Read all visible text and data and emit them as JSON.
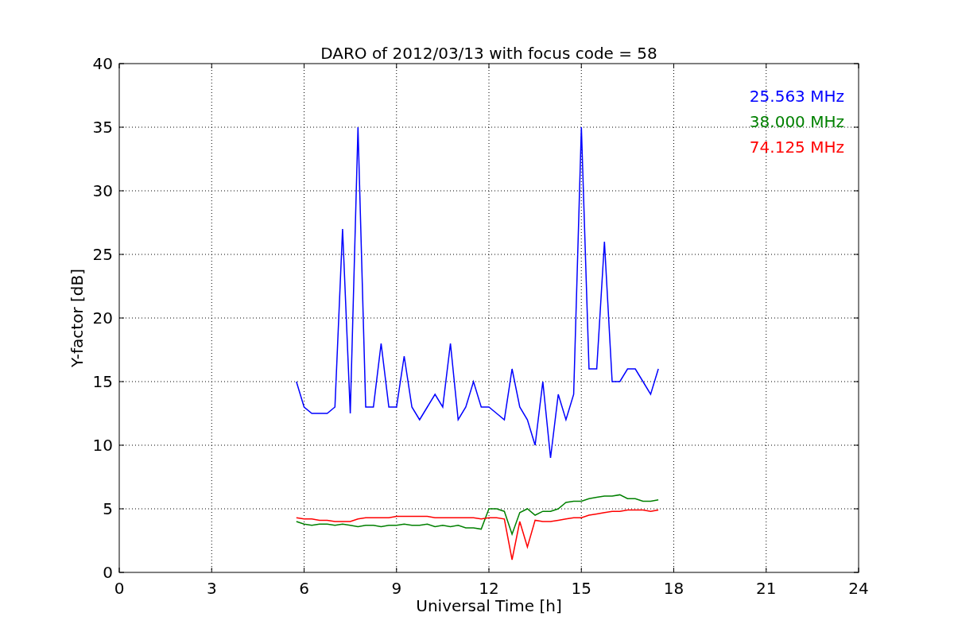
{
  "figure": {
    "chart_data": {
      "type": "line",
      "title": "DARO of 2012/03/13 with focus code = 58",
      "xlabel": "Universal Time [h]",
      "ylabel": "Y-factor [dB]",
      "x": [
        5.75,
        6,
        6.25,
        6.5,
        6.75,
        7,
        7.25,
        7.5,
        7.75,
        8,
        8.25,
        8.5,
        8.75,
        9,
        9.25,
        9.5,
        9.75,
        10,
        10.25,
        10.5,
        10.75,
        11,
        11.25,
        11.5,
        11.75,
        12,
        12.25,
        12.5,
        12.75,
        13,
        13.25,
        13.5,
        13.75,
        14,
        14.25,
        14.5,
        14.75,
        15,
        15.25,
        15.5,
        15.75,
        16,
        16.25,
        16.5,
        16.75,
        17,
        17.25,
        17.5
      ],
      "series": [
        {
          "name": "25.563 MHz",
          "color": "#0000ff",
          "values": [
            15,
            13,
            12.5,
            12.5,
            12.5,
            13,
            27,
            12.5,
            35,
            13,
            13,
            18,
            13,
            13,
            17,
            13,
            12,
            13,
            14,
            13,
            18,
            12,
            13,
            15,
            13,
            13,
            12.5,
            12,
            16,
            13,
            12,
            10,
            15,
            9,
            14,
            12,
            14,
            35,
            16,
            16,
            26,
            15,
            15,
            16,
            16,
            15,
            14,
            16
          ]
        },
        {
          "name": "38.000 MHz",
          "color": "#008000",
          "values": [
            4,
            3.8,
            3.7,
            3.8,
            3.8,
            3.7,
            3.8,
            3.7,
            3.6,
            3.7,
            3.7,
            3.6,
            3.7,
            3.7,
            3.8,
            3.7,
            3.7,
            3.8,
            3.6,
            3.7,
            3.6,
            3.7,
            3.5,
            3.5,
            3.4,
            5,
            5,
            4.8,
            3,
            4.7,
            5,
            4.5,
            4.8,
            4.8,
            5,
            5.5,
            5.6,
            5.6,
            5.8,
            5.9,
            6,
            6,
            6.1,
            5.8,
            5.8,
            5.6,
            5.6,
            5.7
          ]
        },
        {
          "name": "74.125 MHz",
          "color": "#ff0000",
          "values": [
            4.3,
            4.2,
            4.2,
            4.1,
            4.1,
            4.0,
            4.0,
            4.0,
            4.2,
            4.3,
            4.3,
            4.3,
            4.3,
            4.4,
            4.4,
            4.4,
            4.4,
            4.4,
            4.3,
            4.3,
            4.3,
            4.3,
            4.3,
            4.3,
            4.2,
            4.3,
            4.3,
            4.2,
            1,
            4.0,
            2,
            4.1,
            4.0,
            4.0,
            4.1,
            4.2,
            4.3,
            4.3,
            4.5,
            4.6,
            4.7,
            4.8,
            4.8,
            4.9,
            4.9,
            4.9,
            4.8,
            4.9
          ]
        }
      ],
      "grid": true,
      "xlim": [
        0,
        24
      ],
      "ylim": [
        0,
        40
      ],
      "xticks": [
        0,
        3,
        6,
        9,
        12,
        15,
        18,
        21,
        24
      ],
      "yticks": [
        0,
        5,
        10,
        15,
        20,
        25,
        30,
        35,
        40
      ]
    }
  }
}
